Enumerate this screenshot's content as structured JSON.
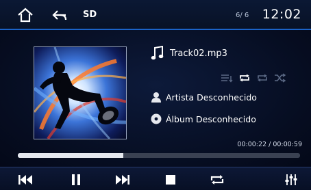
{
  "header": {
    "source": "SD",
    "track_count": "6/ 6",
    "clock": "12:02"
  },
  "track": {
    "title": "Track02.mp3",
    "artist": "Artista Desconhecido",
    "album": "Álbum Desconhecido"
  },
  "playback": {
    "elapsed_total": "00:00:22 / 00:00:59",
    "progress_fraction": 0.373
  },
  "icons": {
    "home": "home-icon",
    "back": "back-arrow-icon",
    "note": "music-note-icon",
    "list": "list-icon",
    "repeat": "repeat-icon",
    "repeat_one": "repeat-one-icon",
    "shuffle": "shuffle-icon",
    "artist": "person-icon",
    "album": "disc-icon",
    "prev": "skip-previous-icon",
    "pause": "pause-icon",
    "next": "skip-next-icon",
    "stop": "stop-icon",
    "equalizer": "equalizer-icon"
  },
  "colors": {
    "accent": "#1b63c8",
    "background": "#050b1c",
    "mode_active": "#ffffff",
    "mode_inactive": "#5c6a86"
  }
}
